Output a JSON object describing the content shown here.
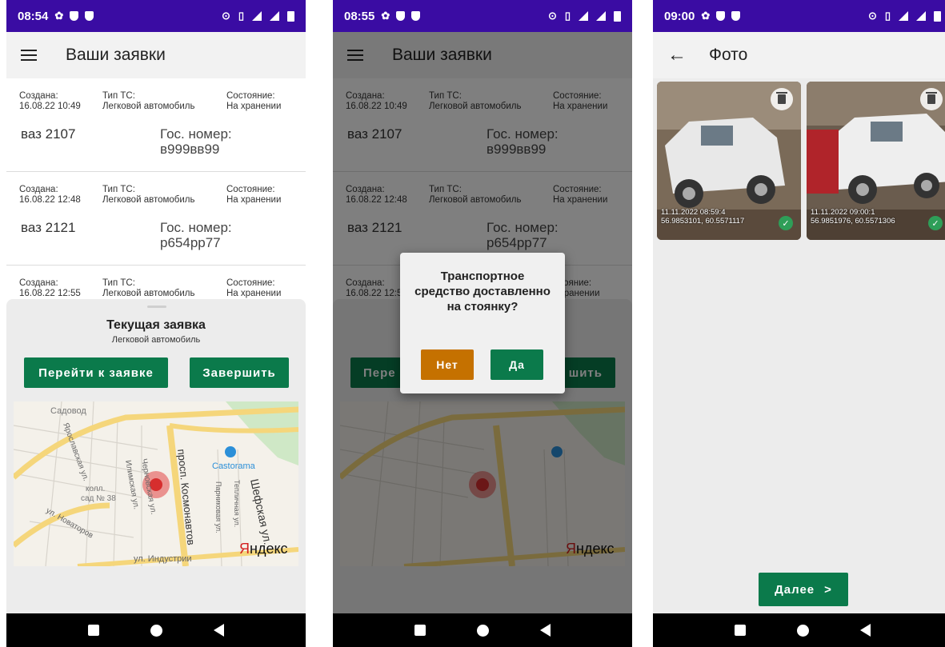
{
  "screens": [
    {
      "status": {
        "time": "08:54"
      },
      "appbar": {
        "title": "Ваши заявки"
      },
      "cards": [
        {
          "created_label": "Создана:",
          "created": "16.08.22 10:49",
          "type_label": "Тип ТС:",
          "type": "Легковой автомобиль",
          "state_label": "Состояние:",
          "state": "На хранении",
          "model": "ваз 2107",
          "plate_label": "Гос. номер:",
          "plate": "в999вв99"
        },
        {
          "created_label": "Создана:",
          "created": "16.08.22 12:48",
          "type_label": "Тип ТС:",
          "type": "Легковой автомобиль",
          "state_label": "Состояние:",
          "state": "На хранении",
          "model": "ваз 2121",
          "plate_label": "Гос. номер:",
          "plate": "р654рр77"
        },
        {
          "created_label": "Создана:",
          "created": "16.08.22 12:55",
          "type_label": "Тип ТС:",
          "type": "Легковой автомобиль",
          "state_label": "Состояние:",
          "state": "На хранении"
        }
      ],
      "sheet": {
        "title": "Текущая заявка",
        "subtitle": "Легковой автомобиль",
        "goto_label": "Перейти к заявке",
        "finish_label": "Завершить"
      },
      "map": {
        "labels": [
          "Садовод",
          "Ярославская ул.",
          "Илимская ул.",
          "Черновская ул.",
          "колл.",
          "сад № 38",
          "ул. Новаторов",
          "просп. Космонавтов",
          "Castorama",
          "Парниковая ул.",
          "Тепличная ул.",
          "Шефская ул.",
          "ул. Индустрии"
        ],
        "logo": "Яндекс"
      }
    },
    {
      "status": {
        "time": "08:55"
      },
      "appbar": {
        "title": "Ваши заявки"
      },
      "cards": [
        {
          "created_label": "Создана:",
          "created": "16.08.22 10:49",
          "type_label": "Тип ТС:",
          "type": "Легковой автомобиль",
          "state_label": "Состояние:",
          "state": "На хранении",
          "model": "ваз 2107",
          "plate_label": "Гос. номер:",
          "plate": "в999вв99"
        },
        {
          "created_label": "Создана:",
          "created": "16.08.22 12:48",
          "type_label": "Тип ТС:",
          "type": "Легковой автомобиль",
          "state_label": "Состояние:",
          "state": "На хранении",
          "model": "ваз 2121",
          "plate_label": "Гос. номер:",
          "plate": "р654рр77"
        },
        {
          "created_label": "Создана:",
          "created": "16.08.22 12:5",
          "type_label": "",
          "type": "",
          "state_label": "тояние:",
          "state": "хранении"
        }
      ],
      "sheet": {
        "goto_label": "Пере",
        "finish_label": "шить"
      },
      "dialog": {
        "question": "Транспортное средство доставленно на стоянку?",
        "no_label": "Нет",
        "yes_label": "Да"
      },
      "map": {
        "logo": "Яндекс"
      }
    },
    {
      "status": {
        "time": "09:00"
      },
      "appbar": {
        "title": "Фото"
      },
      "photos": [
        {
          "caption_line1": "11.11.2022 08:59:4",
          "caption_line2": "56.9853101, 60.5571117"
        },
        {
          "caption_line1": "11.11.2022 09:00:1",
          "caption_line2": "56.9851976, 60.5571306"
        }
      ],
      "next_label": "Далее"
    }
  ],
  "colors": {
    "statusbar": "#3a0ca3",
    "primary_green": "#0b7a4b",
    "orange": "#c57100"
  }
}
